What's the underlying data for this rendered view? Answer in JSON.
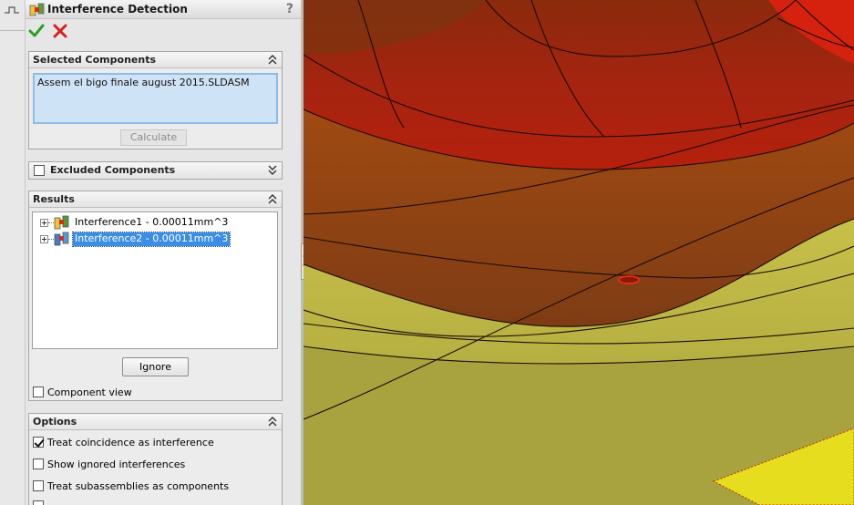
{
  "panel": {
    "title": "Interference Detection",
    "help": "?",
    "ok_icon": "checkmark-icon",
    "cancel_icon": "x-icon"
  },
  "selected_components": {
    "title": "Selected Components",
    "items": [
      "Assem el bigo finale august 2015.SLDASM"
    ],
    "calculate_label": "Calculate"
  },
  "excluded_components": {
    "title": "Excluded Components",
    "checked": false
  },
  "results": {
    "title": "Results",
    "items": [
      {
        "label": "Interference1 - 0.00011mm^3",
        "selected": false
      },
      {
        "label": "Interference2 - 0.00011mm^3",
        "selected": true
      }
    ],
    "ignore_label": "Ignore",
    "component_view_label": "Component view",
    "component_view_checked": false
  },
  "options": {
    "title": "Options",
    "items": [
      {
        "label": "Treat coincidence as interference",
        "checked": true
      },
      {
        "label": "Show ignored interferences",
        "checked": false
      },
      {
        "label": "Treat subassemblies as components",
        "checked": false
      }
    ]
  },
  "colors": {
    "highlight": "#3a8ee6",
    "list_bg": "#cfe3f6",
    "ok_green": "#2aa02a",
    "cancel_red": "#d42020",
    "model_red": "#b51e0a",
    "model_brown": "#9a4a10",
    "model_yellow": "#b6b043"
  }
}
